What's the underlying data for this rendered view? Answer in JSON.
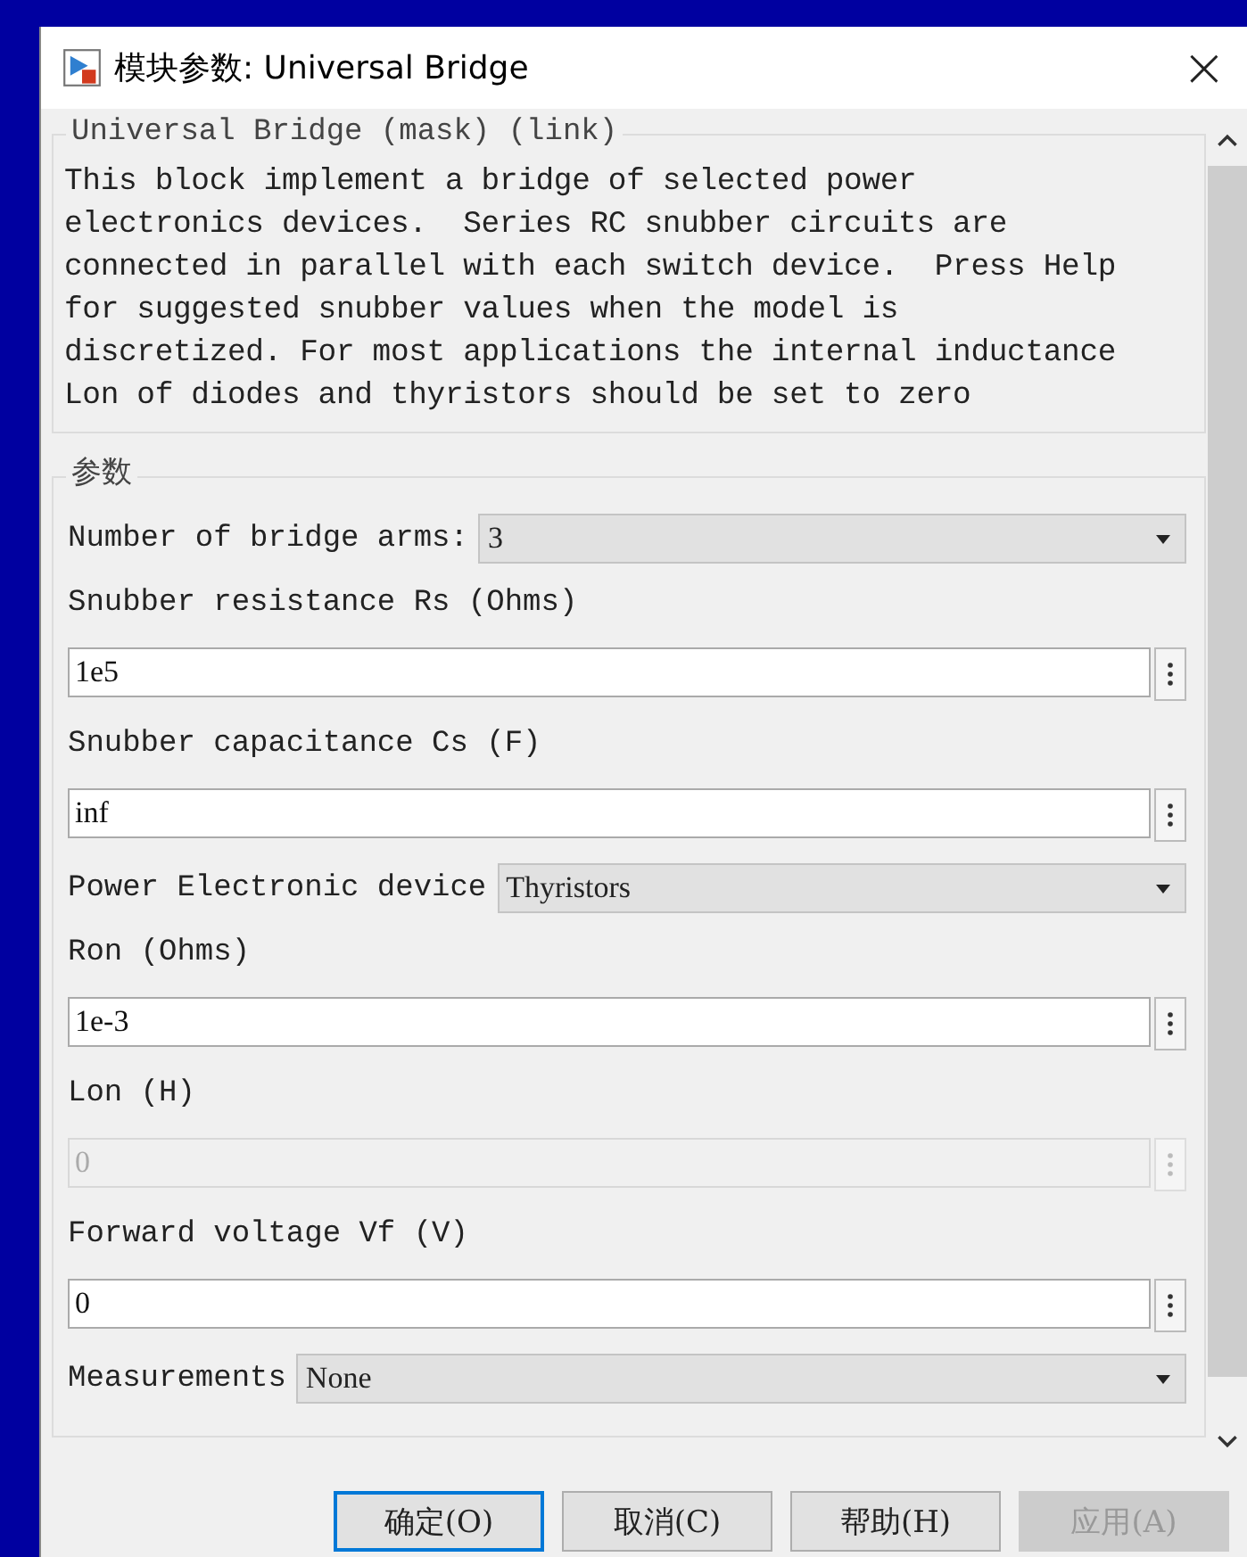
{
  "window": {
    "title": "模块参数: Universal Bridge",
    "close": "×"
  },
  "description": {
    "legend": "Universal Bridge (mask) (link)",
    "text": "This block implement a bridge of selected power\nelectronics devices.  Series RC snubber circuits are\nconnected in parallel with each switch device.  Press Help\nfor suggested snubber values when the model is\ndiscretized. For most applications the internal inductance\nLon of diodes and thyristors should be set to zero"
  },
  "parameters": {
    "legend": "参数",
    "items": [
      {
        "kind": "dropdown",
        "label": "Number of bridge arms:",
        "value": "3"
      },
      {
        "kind": "edit",
        "label": "Snubber resistance Rs (Ohms)",
        "value": "1e5",
        "disabled": false
      },
      {
        "kind": "edit",
        "label": "Snubber capacitance Cs (F)",
        "value": "inf",
        "disabled": false
      },
      {
        "kind": "dropdown",
        "label": "Power Electronic device",
        "value": "Thyristors"
      },
      {
        "kind": "edit",
        "label": "Ron (Ohms)",
        "value": "1e-3",
        "disabled": false
      },
      {
        "kind": "edit",
        "label": "Lon (H)",
        "value": "0",
        "disabled": true
      },
      {
        "kind": "edit",
        "label": "Forward voltage Vf (V)",
        "value": "0",
        "disabled": false
      },
      {
        "kind": "dropdown",
        "label": "Measurements",
        "value": "None"
      }
    ]
  },
  "buttons": [
    {
      "label": "确定(O)",
      "default": true,
      "disabled": false
    },
    {
      "label": "取消(C)",
      "default": false,
      "disabled": false
    },
    {
      "label": "帮助(H)",
      "default": false,
      "disabled": false
    },
    {
      "label": "应用(A)",
      "default": false,
      "disabled": true
    }
  ]
}
